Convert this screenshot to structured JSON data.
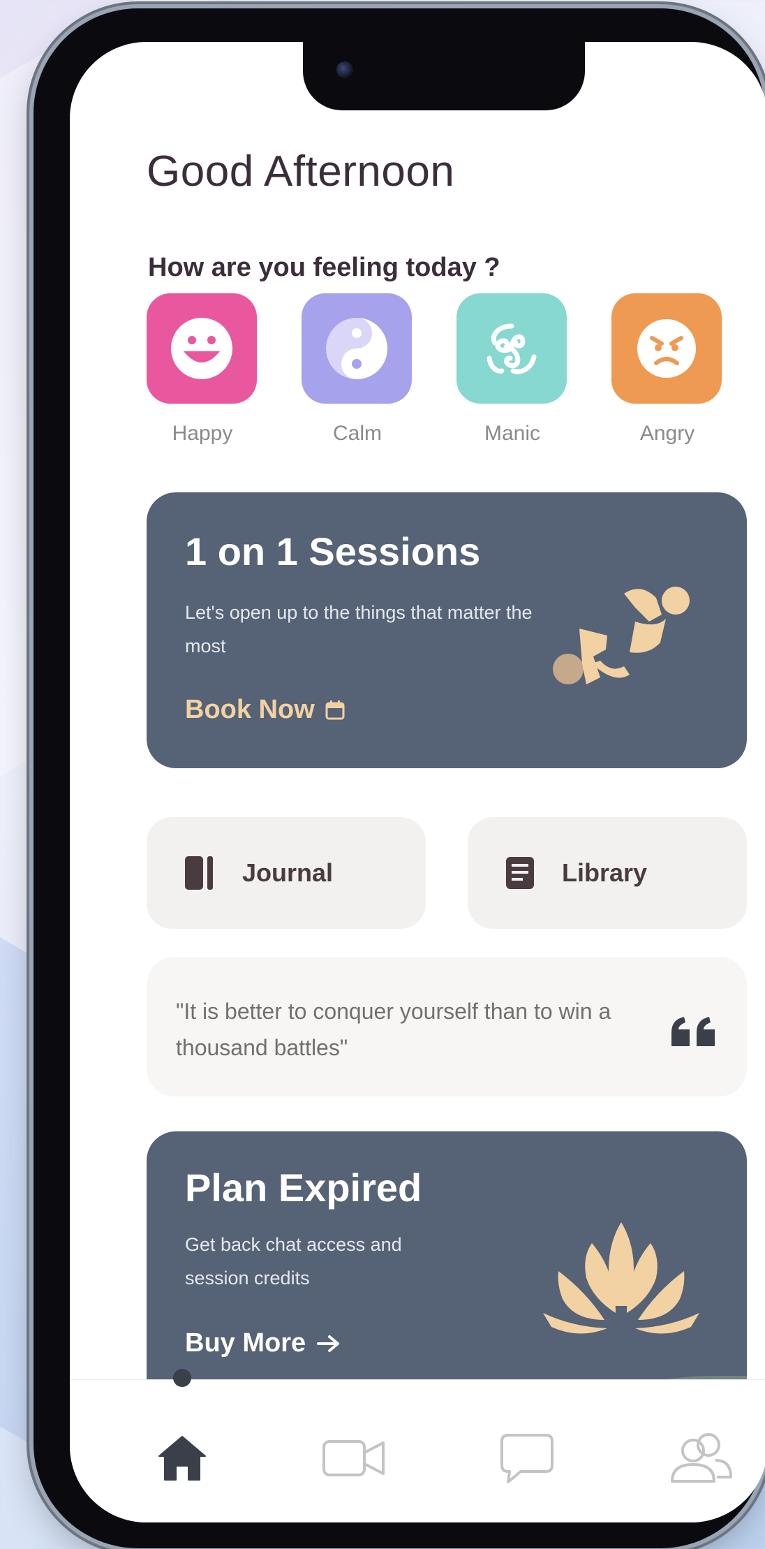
{
  "greeting": "Good Afternoon",
  "mood_prompt": "How are you feeling today ?",
  "moods": [
    {
      "label": "Happy",
      "color": "#e9579f",
      "icon": "smile-icon"
    },
    {
      "label": "Calm",
      "color": "#a6a2ec",
      "icon": "yin-yang-icon"
    },
    {
      "label": "Manic",
      "color": "#87d8d0",
      "icon": "triskelion-icon"
    },
    {
      "label": "Angry",
      "color": "#ee9a52",
      "icon": "angry-face-icon"
    },
    {
      "label": "",
      "color": "#9fe09a",
      "icon": "partial-mood-icon"
    }
  ],
  "sessions_card": {
    "title": "1 on 1 Sessions",
    "subtitle": "Let's open up to the things that matter the most",
    "cta": "Book Now",
    "cta_icon": "calendar-icon",
    "illustration": "yoga-figures-illustration",
    "background": "#566275",
    "cta_color": "#f2d2a3"
  },
  "quick_links": [
    {
      "label": "Journal",
      "icon": "journal-icon"
    },
    {
      "label": "Library",
      "icon": "library-icon"
    }
  ],
  "quote": {
    "text": "\"It is better to conquer yourself than to win a thousand battles\"",
    "icon": "quote-icon"
  },
  "plan_card": {
    "title": "Plan Expired",
    "subtitle": "Get back chat access and session credits",
    "cta": "Buy More",
    "cta_icon": "arrow-right-icon",
    "illustration": "lotus-illustration"
  },
  "bottom_nav": [
    {
      "name": "home",
      "icon": "home-icon",
      "active": true
    },
    {
      "name": "video",
      "icon": "video-camera-icon",
      "active": false
    },
    {
      "name": "chat",
      "icon": "chat-bubble-icon",
      "active": false
    },
    {
      "name": "community",
      "icon": "users-icon",
      "active": false
    }
  ]
}
